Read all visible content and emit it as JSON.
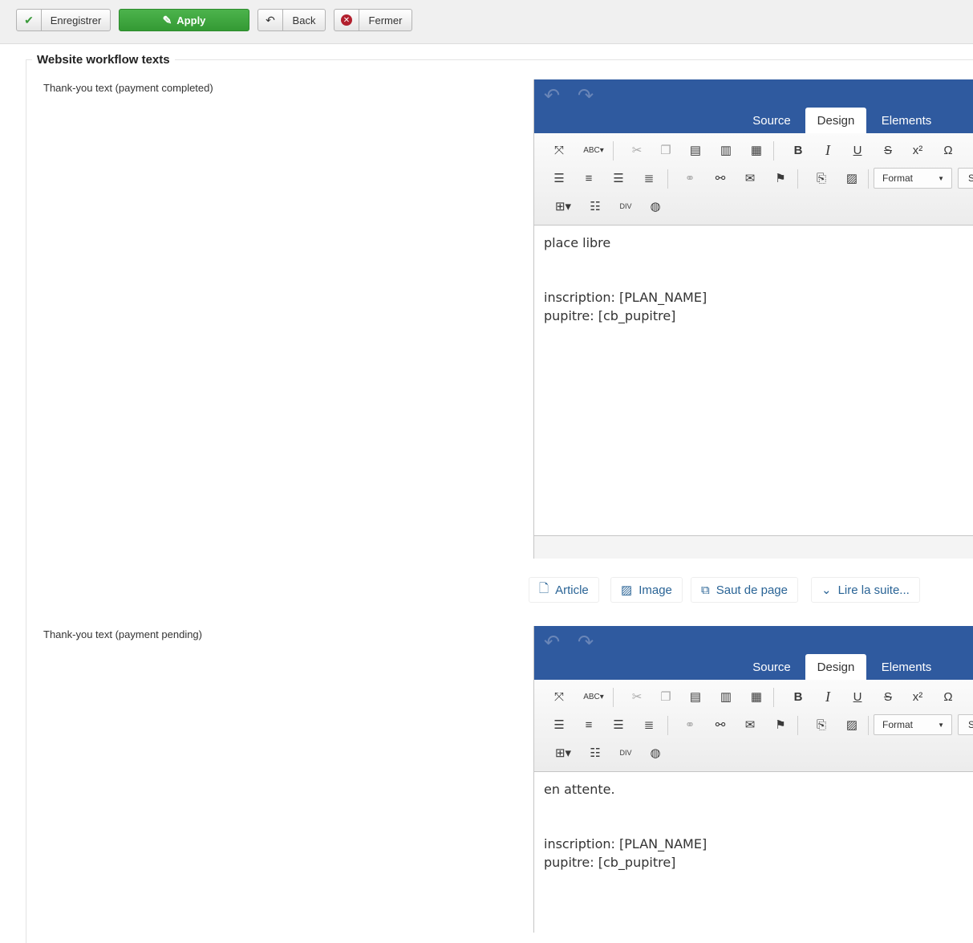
{
  "toolbar": {
    "save_label": "Enregistrer",
    "apply_label": "Apply",
    "back_label": "Back",
    "close_label": "Fermer"
  },
  "section": {
    "legend": "Website workflow texts"
  },
  "fields": [
    {
      "label": "Thank-you text (payment completed)",
      "editor": {
        "tabs": [
          "Source",
          "Design",
          "Elements"
        ],
        "active_tab": "Design",
        "format_label": "Format",
        "style_label": "S",
        "lines": [
          "place libre",
          "",
          "",
          "inscription: [PLAN_NAME]",
          "pupitre: [cb_pupitre]"
        ]
      }
    },
    {
      "label": "Thank-you text (payment pending)",
      "editor": {
        "tabs": [
          "Source",
          "Design",
          "Elements"
        ],
        "active_tab": "Design",
        "format_label": "Format",
        "style_label": "S",
        "lines": [
          "en attente.",
          "",
          "",
          "inscription: [PLAN_NAME]",
          "pupitre: [cb_pupitre]"
        ]
      }
    }
  ],
  "extra_buttons": [
    {
      "label": "Article",
      "icon": "file-add-icon"
    },
    {
      "label": "Image",
      "icon": "image-icon"
    },
    {
      "label": "Saut de page",
      "icon": "copy-icon"
    },
    {
      "label": "Lire la suite...",
      "icon": "chevron-down-icon"
    }
  ],
  "colors": {
    "editor_header": "#2f5a9f",
    "apply_green": "#3ea63e",
    "link_blue": "#2a6496"
  }
}
